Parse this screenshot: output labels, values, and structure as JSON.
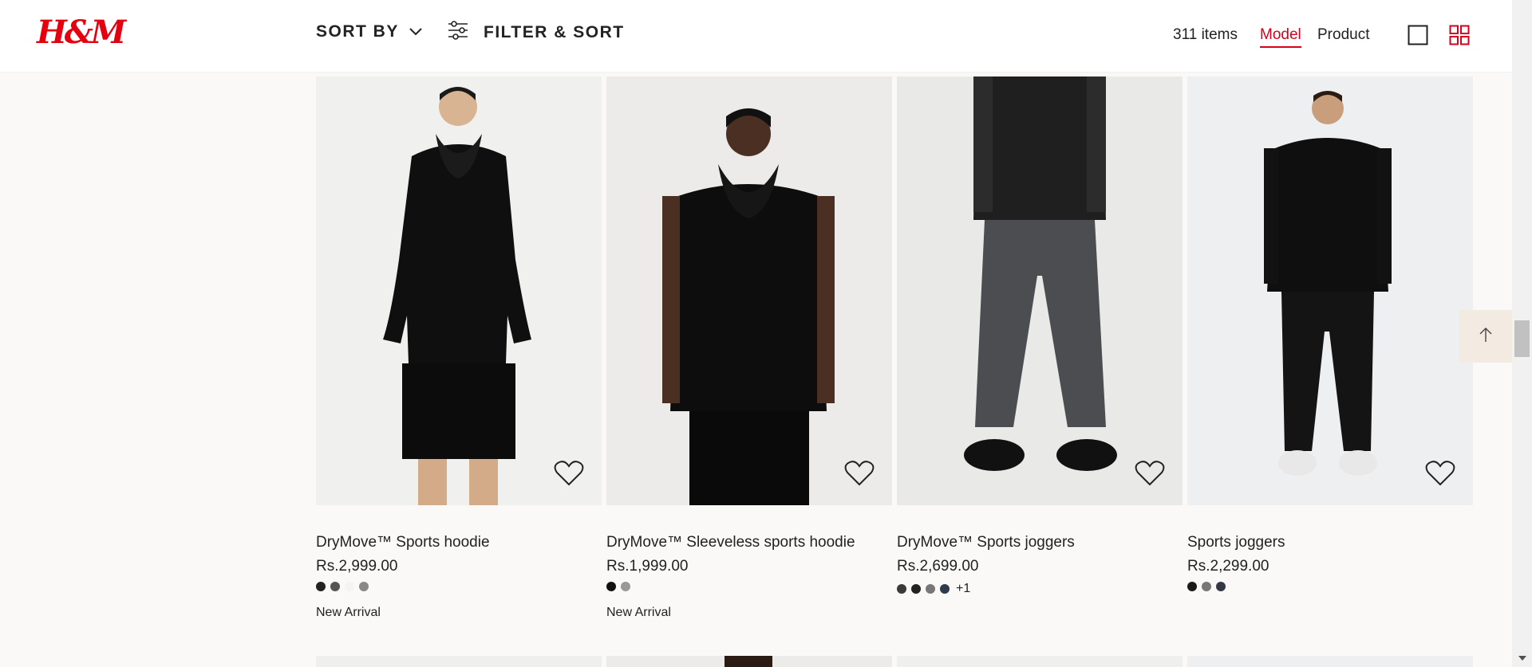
{
  "header": {
    "logo": "H&M",
    "sort_label": "SORT BY",
    "filter_label": "FILTER & SORT",
    "item_count": "311 items",
    "view_model": "Model",
    "view_product": "Product"
  },
  "products": [
    {
      "title": "DryMove™ Sports hoodie",
      "price": "Rs.2,999.00",
      "swatches": [
        "#222222",
        "#555555",
        "#f4f4f4",
        "#888888"
      ],
      "more": "",
      "badge": "New Arrival"
    },
    {
      "title": "DryMove™ Sleeveless sports hoodie",
      "price": "Rs.1,999.00",
      "swatches": [
        "#111111",
        "#999999"
      ],
      "more": "",
      "badge": "New Arrival"
    },
    {
      "title": "DryMove™ Sports joggers",
      "price": "Rs.2,699.00",
      "swatches": [
        "#3a3a3a",
        "#222222",
        "#777777",
        "#2f3a4a"
      ],
      "more": "+1",
      "badge": ""
    },
    {
      "title": "Sports joggers",
      "price": "Rs.2,299.00",
      "swatches": [
        "#1a1a1a",
        "#777777",
        "#333844"
      ],
      "more": "",
      "badge": ""
    }
  ],
  "icons": {
    "sort": "chevron-down-icon",
    "filter": "sliders-icon",
    "grid_single": "single-view-icon",
    "grid_multi": "grid-view-icon",
    "favorite": "heart-icon",
    "back_to_top": "arrow-up-icon"
  },
  "colors": {
    "brand": "#e50010",
    "accent": "#d6001c",
    "page_bg": "#faf9f8",
    "back_top_bg": "#f3ebe1"
  }
}
